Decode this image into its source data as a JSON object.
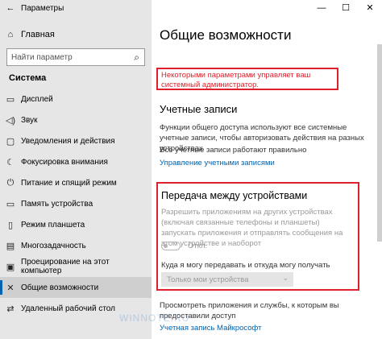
{
  "window": {
    "title": "Параметры",
    "minimize": "—",
    "maximize": "☐",
    "close": "✕"
  },
  "sidebar": {
    "back_icon": "←",
    "home": {
      "icon": "⌂",
      "label": "Главная"
    },
    "search": {
      "placeholder": "Найти параметр",
      "icon": "⌕"
    },
    "section_title": "Система",
    "items": [
      {
        "icon": "▭",
        "label": "Дисплей"
      },
      {
        "icon": "◁)",
        "label": "Звук"
      },
      {
        "icon": "▢",
        "label": "Уведомления и действия"
      },
      {
        "icon": "☾",
        "label": "Фокусировка внимания"
      },
      {
        "icon": "⏻",
        "label": "Питание и спящий режим"
      },
      {
        "icon": "▭",
        "label": "Память устройства"
      },
      {
        "icon": "▯",
        "label": "Режим планшета"
      },
      {
        "icon": "▤",
        "label": "Многозадачность"
      },
      {
        "icon": "▣",
        "label": "Проецирование на этот компьютер"
      },
      {
        "icon": "✕",
        "label": "Общие возможности"
      },
      {
        "icon": "⇄",
        "label": "Удаленный рабочий стол"
      }
    ],
    "active_index": 9
  },
  "main": {
    "title": "Общие возможности",
    "admin_note": "Некоторыми параметрами управляет ваш системный администратор.",
    "accounts": {
      "heading": "Учетные записи",
      "description": "Функции общего доступа используют все системные учетные записи, чтобы авторизовать действия на разных устройствах",
      "status": "Все учетные записи работают правильно",
      "link": "Управление учетными записями"
    },
    "transfer": {
      "heading": "Передача между устройствами",
      "description": "Разрешить приложениям на других устройствах (включая связанные телефоны и планшеты) запускать приложения и отправлять сообщения на этом устройстве и наоборот",
      "toggle_state": "Откл.",
      "question": "Куда я могу передавать и откуда могу получать",
      "dropdown_value": "Только мои устройства",
      "dropdown_icon": "⌄"
    },
    "footer": {
      "description": "Просмотреть приложения и службы, к которым вы предоставили доступ",
      "link": "Учетная запись Майкрософт"
    },
    "watermark": "WINNOTE.RU"
  },
  "colors": {
    "accent": "#0063b1",
    "highlight": "#e0202a",
    "sidebar_bg": "#e6e6e6"
  }
}
